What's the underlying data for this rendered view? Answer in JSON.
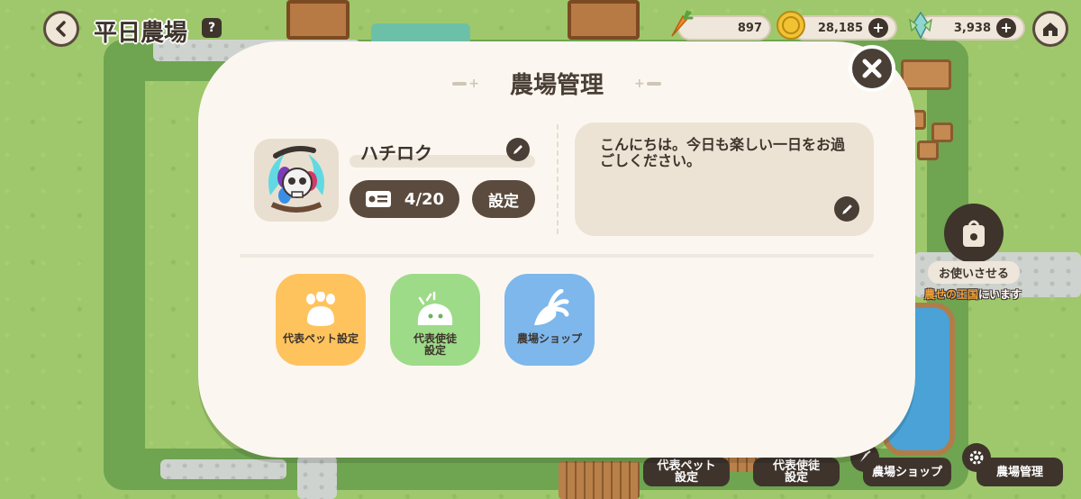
{
  "header": {
    "back_icon": "chevron-left-icon",
    "farm_name": "平日農場",
    "help_label": "?"
  },
  "currencies": [
    {
      "name": "carrot",
      "icon": "carrot-icon",
      "value": "897"
    },
    {
      "name": "coin",
      "icon": "gold-coin-icon",
      "value": "28,185"
    },
    {
      "name": "gem",
      "icon": "crystal-icon",
      "value": "3,938"
    }
  ],
  "side": {
    "use_label": "お使いさせる",
    "location_highlight": "農せの王国",
    "location_suffix": "にいます"
  },
  "bottom_bar": {
    "pet_label": "代表ペット\n設定",
    "servant_label": "代表使徒\n設定",
    "shop_label": "農場ショップ",
    "manage_label": "農場管理"
  },
  "modal": {
    "title": "農場管理",
    "close_icon": "close-icon",
    "pet_name": "ハチロク",
    "count": "4/20",
    "settings_label": "設定",
    "greeting": "こんにちは。今日も楽しい一日をお過ごしください。",
    "features": [
      {
        "label": "代表ペット設定",
        "icon": "paw-icon"
      },
      {
        "label": "代表使徒\n設定",
        "icon": "slime-icon"
      },
      {
        "label": "農場ショップ",
        "icon": "turnip-icon"
      }
    ]
  },
  "colors": {
    "modal_bg": "#fbf7f0",
    "dark_brown": "#4a3f36",
    "pet_tile": "#ffc35e",
    "servant_tile": "#9ddb88",
    "shop_tile": "#7db7ec"
  }
}
